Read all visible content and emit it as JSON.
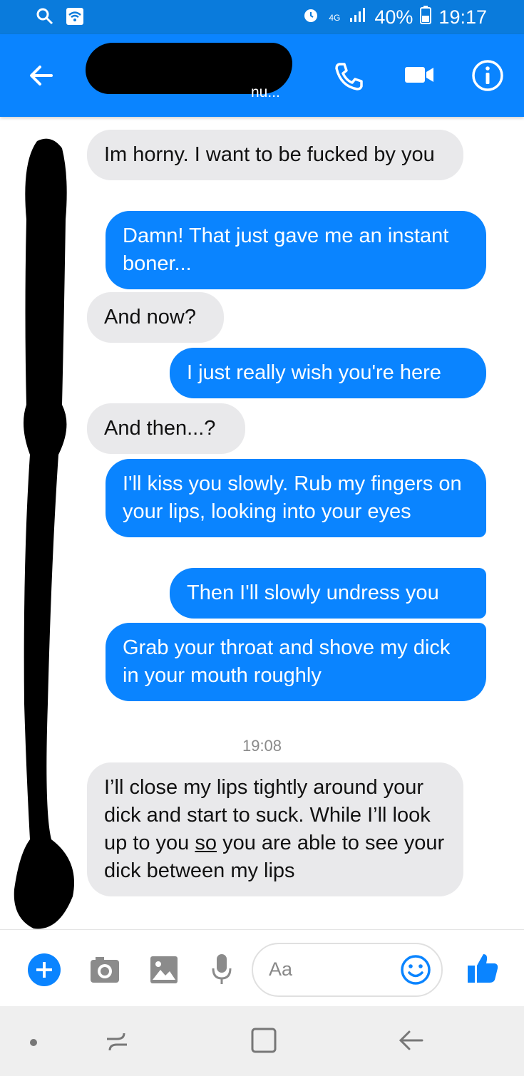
{
  "status_bar": {
    "network": "4G",
    "battery": "40%",
    "time": "19:17",
    "left_icons": [
      "search-icon",
      "wifi-icon"
    ],
    "right_icons": [
      "alarm-icon",
      "signal-icon",
      "battery-icon"
    ]
  },
  "header": {
    "subtitle_fragment": "nu...",
    "actions": [
      "call-icon",
      "video-icon",
      "info-icon"
    ],
    "accent_color": "#0a84ff"
  },
  "messages": [
    {
      "sender": "them",
      "text": "Im horny. I want to be fucked by you"
    },
    {
      "sender": "me",
      "text": "Damn! That just gave me an instant boner..."
    },
    {
      "sender": "them",
      "text": "And now?"
    },
    {
      "sender": "me",
      "text": "I just really wish you're here"
    },
    {
      "sender": "them",
      "text": "And then...?"
    },
    {
      "sender": "me",
      "text": "I'll kiss you slowly. Rub my fingers on your lips, looking into your eyes"
    },
    {
      "sender": "me",
      "text": "Then I'll slowly undress you"
    },
    {
      "sender": "me",
      "text": "Grab your throat and shove my dick in your mouth roughly"
    },
    {
      "sender": "them",
      "text_before": "I’ll close my lips tightly around your dick and start to suck. While I’ll look up to you ",
      "underlined": "so",
      "text_after": " you are able to see your dick between my lips"
    }
  ],
  "timestamp": "19:08",
  "composer": {
    "placeholder": "Aa",
    "icons": [
      "plus-icon",
      "camera-icon",
      "gallery-icon",
      "microphone-icon",
      "emoji-icon",
      "thumbs-up-icon"
    ]
  },
  "nav_bar": {
    "icons": [
      "dot-icon",
      "recents-icon",
      "home-icon",
      "back-icon"
    ]
  }
}
